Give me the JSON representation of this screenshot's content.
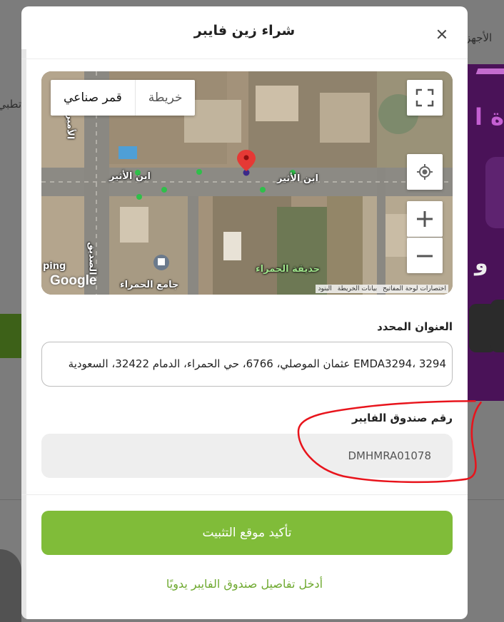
{
  "background": {
    "text_top_right": "الأجهز",
    "text_left": "تطبي",
    "purple_letters": "ة ا",
    "purple_letters_2": "و"
  },
  "modal": {
    "title": "شراء زين فايبر",
    "close_icon": "close-icon"
  },
  "map": {
    "type_options": {
      "satellite": "قمر صناعي",
      "road": "خريطة"
    },
    "labels": {
      "street_left": "ابن الأثير",
      "street_right": "ابن الأثير",
      "park": "حديقة الحمراء",
      "mosque": "جامع الحمراء",
      "road_vertical": "الأمير",
      "road_vertical_2": "الصديق",
      "edge_left": "ping"
    },
    "google_logo": "Google",
    "attribution": [
      "اختصارات لوحة المفاتيح",
      "بيانات الخريطة",
      "البنود"
    ],
    "controls": {
      "zoom_in": "+",
      "zoom_out": "−"
    },
    "colors": {
      "pin": "#e53935",
      "poi": "#2fbf4a"
    }
  },
  "form": {
    "address_label": "العنوان المحدد",
    "address_value": "EMDA3294، 3294 عثمان الموصلي، 6766، حي الحمراء، الدمام 32422، السعودية",
    "fiber_box_label": "رقم صندوق الفايبر",
    "fiber_box_value": "DMHMRA01078"
  },
  "actions": {
    "confirm": "تأكيد موقع التثبيت",
    "manual_entry": "أدخل تفاصيل صندوق الفايبر يدويًا"
  },
  "colors": {
    "accent": "#80bc39",
    "link": "#6ea92f",
    "annotation": "#e8141c"
  }
}
